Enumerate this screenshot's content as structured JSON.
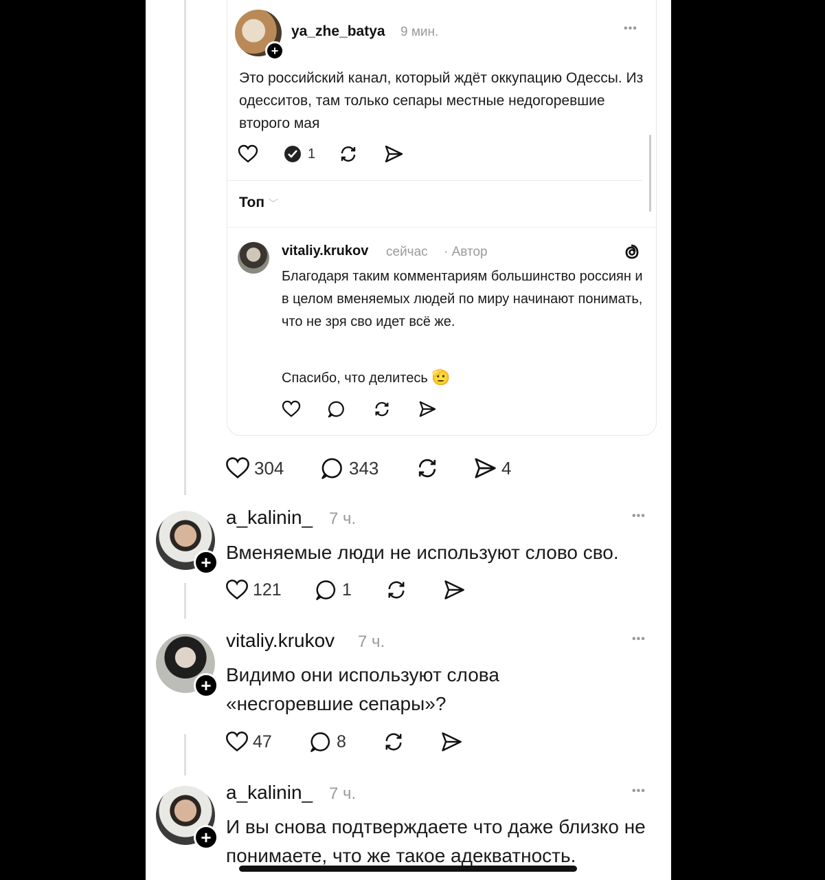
{
  "quoted_post": {
    "author": "ya_zhe_batya",
    "time": "9 мин.",
    "more": "•••",
    "text": "Это российский канал, который ждёт оккупацию Одессы. Из одесситов, там только сепары местные недогоревшие второго мая",
    "actions": {
      "like_icon": "heart-icon",
      "reply_icon": "reply-checked-icon",
      "reply_count": "1",
      "repost_icon": "repost-icon",
      "share_icon": "send-icon"
    },
    "sort_label": "Топ",
    "reply": {
      "author": "vitaliy.krukov",
      "time": "сейчас",
      "badge": "· Автор",
      "text": "Благодаря таким комментариям большинство россиян и в целом вменяемых людей по миру начинают понимать, что не зря сво идет всё же.",
      "text2": "Спасибо, что делитесь",
      "emoji": "🫡"
    }
  },
  "post_stats": {
    "likes": "304",
    "replies": "343",
    "shares": "4"
  },
  "comments": [
    {
      "author": "a_kalinin_",
      "time": "7 ч.",
      "more": "•••",
      "text": "Вменяемые люди не используют слово сво.",
      "likes": "121",
      "replies": "1"
    },
    {
      "author": "vitaliy.krukov",
      "time": "7 ч.",
      "more": "•••",
      "text": "Видимо они используют слова «несгоревшие сепары»?",
      "likes": "47",
      "replies": "8"
    },
    {
      "author": "a_kalinin_",
      "time": "7 ч.",
      "more": "•••",
      "text": "И вы снова подтверждаете что даже близко не понимаете, что же такое адекватность."
    }
  ],
  "colors": {
    "background": "#000000",
    "screen": "#ffffff",
    "text": "#111111",
    "muted": "#9a9a9a"
  }
}
